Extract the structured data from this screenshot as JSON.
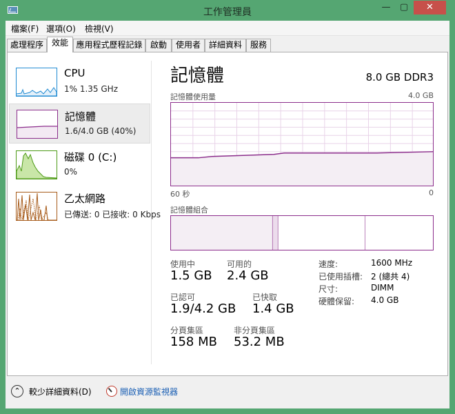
{
  "window": {
    "title": "工作管理員",
    "min_glyph": "—",
    "max_glyph": "▢",
    "close_glyph": "✕"
  },
  "menu": [
    "檔案(F)",
    "選項(O)",
    "檢視(V)"
  ],
  "tabs": [
    "處理程序",
    "效能",
    "應用程式歷程記錄",
    "啟動",
    "使用者",
    "詳細資料",
    "服務"
  ],
  "active_tab": "效能",
  "sidebar": [
    {
      "name": "CPU",
      "sub": "1% 1.35 GHz",
      "color": "#1f8ad2"
    },
    {
      "name": "記憶體",
      "sub": "1.6/4.0 GB (40%)",
      "color": "#8b2c8b"
    },
    {
      "name": "磁碟 0 (C:)",
      "sub": "0%",
      "color": "#4d9a16"
    },
    {
      "name": "乙太網路",
      "sub": "已傳送: 0 已接收: 0 Kbps",
      "color": "#a75b1a"
    }
  ],
  "main": {
    "title": "記憶體",
    "spec": "8.0 GB DDR3",
    "graph_label": "記憶體使用量",
    "graph_max": "4.0 GB",
    "graph_left": "60 秒",
    "graph_right": "0",
    "comp_label": "記憶體組合",
    "usage_fraction": 0.4,
    "accent": "#8b2c8b"
  },
  "stats": {
    "in_use_label": "使用中",
    "in_use": "1.5 GB",
    "available_label": "可用的",
    "available": "2.4 GB",
    "committed_label": "已認可",
    "committed": "1.9/4.2 GB",
    "cached_label": "已快取",
    "cached": "1.4 GB",
    "paged_label": "分頁集區",
    "paged": "158 MB",
    "nonpaged_label": "非分頁集區",
    "nonpaged": "53.2 MB"
  },
  "details": [
    {
      "label": "速度:",
      "value": "1600 MHz"
    },
    {
      "label": "已使用插槽:",
      "value": "2 (總共 4)"
    },
    {
      "label": "尺寸:",
      "value": "DIMM"
    },
    {
      "label": "硬體保留:",
      "value": "4.0 GB"
    }
  ],
  "footer": {
    "fewer": "較少詳細資料(D)",
    "resmon": "開啟資源監視器",
    "fewer_glyph": "⌃"
  }
}
